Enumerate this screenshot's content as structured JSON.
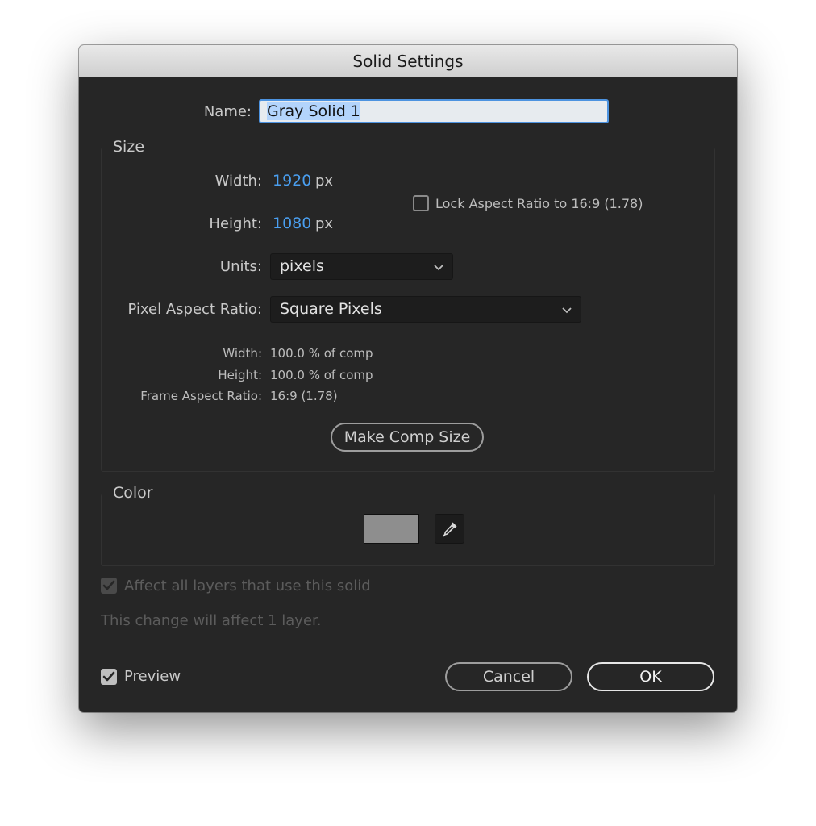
{
  "dialog": {
    "title": "Solid Settings"
  },
  "name_field": {
    "label": "Name:",
    "value": "Gray Solid 1"
  },
  "size": {
    "group_label": "Size",
    "width_label": "Width:",
    "width_value": "1920",
    "width_unit": "px",
    "height_label": "Height:",
    "height_value": "1080",
    "height_unit": "px",
    "lock_aspect_label": "Lock Aspect Ratio to 16:9 (1.78)",
    "lock_aspect_checked": false,
    "units_label": "Units:",
    "units_value": "pixels",
    "par_label": "Pixel Aspect Ratio:",
    "par_value": "Square Pixels",
    "info_width_label": "Width:",
    "info_width_value": "100.0 % of comp",
    "info_height_label": "Height:",
    "info_height_value": "100.0 % of comp",
    "info_far_label": "Frame Aspect Ratio:",
    "info_far_value": "16:9 (1.78)",
    "make_comp_size_label": "Make Comp Size"
  },
  "color": {
    "group_label": "Color",
    "swatch_color": "#8e8e8e",
    "eyedropper_icon": "eyedropper-icon"
  },
  "affect_all": {
    "label": "Affect all layers that use this solid",
    "checked": true,
    "disabled": true,
    "note": "This change will affect 1 layer."
  },
  "preview": {
    "label": "Preview",
    "checked": true
  },
  "buttons": {
    "cancel_label": "Cancel",
    "ok_label": "OK"
  },
  "colors": {
    "dialog_bg": "#262626",
    "accent_blue": "#4a9ff0",
    "focus_ring": "#4d93e0"
  }
}
